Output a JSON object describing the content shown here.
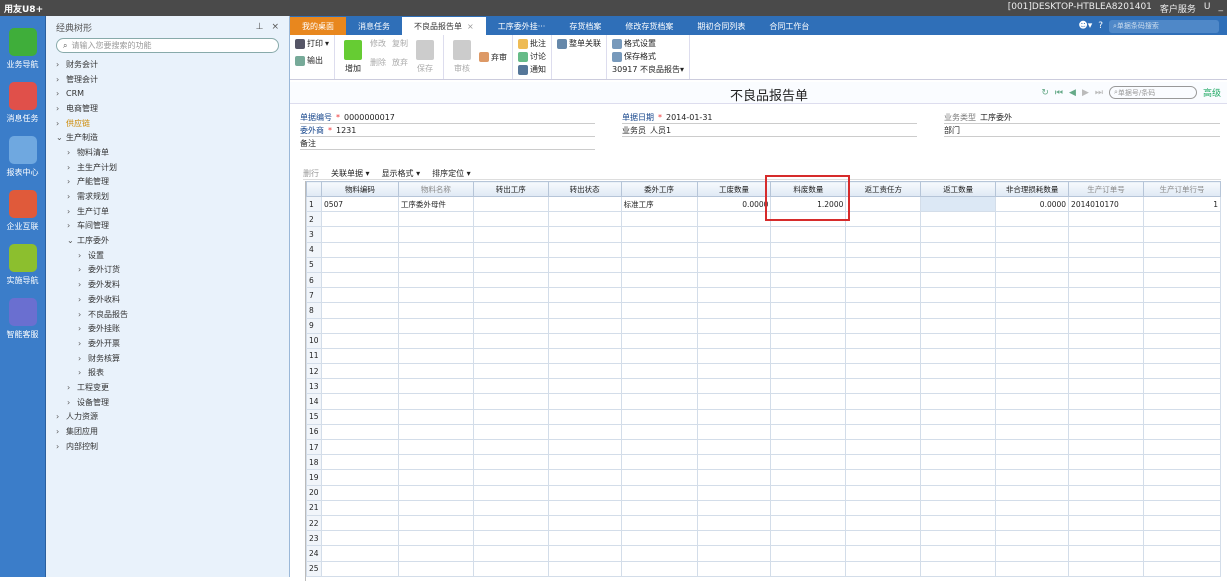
{
  "titlebar": {
    "app": "用友U8+",
    "session": "[001]DESKTOP-HTBLEA8201401",
    "service": "客户服务",
    "u": "U"
  },
  "leftnav": [
    {
      "label": "业务导航",
      "color": "#3fae3a"
    },
    {
      "label": "消息任务",
      "color": "#e0504a"
    },
    {
      "label": "报表中心",
      "color": "#6fa8e0"
    },
    {
      "label": "企业互联",
      "color": "#e05a3a"
    },
    {
      "label": "实施导航",
      "color": "#8cbf2e"
    },
    {
      "label": "智能客服",
      "color": "#6a6fd0"
    }
  ],
  "tree": {
    "title": "经典树形",
    "search_placeholder": "请输入您要搜索的功能",
    "nodes": [
      {
        "label": "财务会计",
        "level": 0,
        "open": false
      },
      {
        "label": "管理会计",
        "level": 0,
        "open": false
      },
      {
        "label": "CRM",
        "level": 0,
        "open": false
      },
      {
        "label": "电商管理",
        "level": 0,
        "open": false
      },
      {
        "label": "供应链",
        "level": 0,
        "open": false,
        "highlight": true
      },
      {
        "label": "生产制造",
        "level": 0,
        "open": true
      },
      {
        "label": "物料清单",
        "level": 1,
        "open": false
      },
      {
        "label": "主生产计划",
        "level": 1,
        "open": false
      },
      {
        "label": "产能管理",
        "level": 1,
        "open": false
      },
      {
        "label": "需求规划",
        "level": 1,
        "open": false
      },
      {
        "label": "生产订单",
        "level": 1,
        "open": false
      },
      {
        "label": "车间管理",
        "level": 1,
        "open": false
      },
      {
        "label": "工序委外",
        "level": 1,
        "open": true
      },
      {
        "label": "设置",
        "level": 2,
        "open": false
      },
      {
        "label": "委外订货",
        "level": 2,
        "open": false
      },
      {
        "label": "委外发料",
        "level": 2,
        "open": false
      },
      {
        "label": "委外收料",
        "level": 2,
        "open": false
      },
      {
        "label": "不良品报告",
        "level": 2,
        "open": false
      },
      {
        "label": "委外挂账",
        "level": 2,
        "open": false
      },
      {
        "label": "委外开票",
        "level": 2,
        "open": false
      },
      {
        "label": "财务核算",
        "level": 2,
        "open": false
      },
      {
        "label": "报表",
        "level": 2,
        "open": false
      },
      {
        "label": "工程变更",
        "level": 1,
        "open": false
      },
      {
        "label": "设备管理",
        "level": 1,
        "open": false
      },
      {
        "label": "人力资源",
        "level": 0,
        "open": false
      },
      {
        "label": "集团应用",
        "level": 0,
        "open": false
      },
      {
        "label": "内部控制",
        "level": 0,
        "open": false
      }
    ]
  },
  "tabs": [
    {
      "label": "我的桌面",
      "kind": "home"
    },
    {
      "label": "消息任务"
    },
    {
      "label": "不良品报告单",
      "kind": "active",
      "close": "×"
    },
    {
      "label": "工序委外挂···"
    },
    {
      "label": "存货档案"
    },
    {
      "label": "修改存货档案"
    },
    {
      "label": "期初合同列表"
    },
    {
      "label": "合同工作台"
    }
  ],
  "tab_search_placeholder": "单据条码搜索",
  "toolbar": {
    "print": "打印",
    "export": "输出",
    "add": "增加",
    "modify": "修改",
    "copy": "复制",
    "delete": "删除",
    "abandon": "放弃",
    "save": "保存",
    "audit": "审核",
    "abandon_audit": "弃审",
    "annotate": "批注",
    "discuss": "讨论",
    "notify": "通知",
    "link": "整单关联",
    "format_setting": "格式设置",
    "save_format": "保存格式",
    "format_select": "30917 不良品报告▾"
  },
  "document": {
    "title": "不良品报告单",
    "search_placeholder": "单据号/条码",
    "advanced": "高级"
  },
  "form": {
    "doc_no_label": "单据编号",
    "doc_no": "0000000017",
    "date_label": "单据日期",
    "date": "2014-01-31",
    "biz_type_label": "业务类型",
    "biz_type": "工序委外",
    "vendor_label": "委外商",
    "vendor": "1231",
    "staff_label": "业务员",
    "staff": "人员1",
    "dept_label": "部门",
    "note_label": "备注"
  },
  "gridbar": {
    "delete_row": "删行",
    "related": "关联单据",
    "display": "显示格式",
    "sort": "排序定位"
  },
  "table": {
    "columns": [
      "物料编码",
      "物料名称",
      "转出工序",
      "转出状态",
      "委外工序",
      "工废数量",
      "料废数量",
      "返工责任方",
      "返工数量",
      "非合理损耗数量",
      "生产订单号",
      "生产订单行号"
    ],
    "rows": [
      [
        "0507",
        "工序委外母件",
        "",
        "",
        "标准工序",
        "0.0000",
        "1.2000",
        "",
        "",
        "0.0000",
        "2014010170",
        "1"
      ]
    ],
    "row_count": 25
  }
}
